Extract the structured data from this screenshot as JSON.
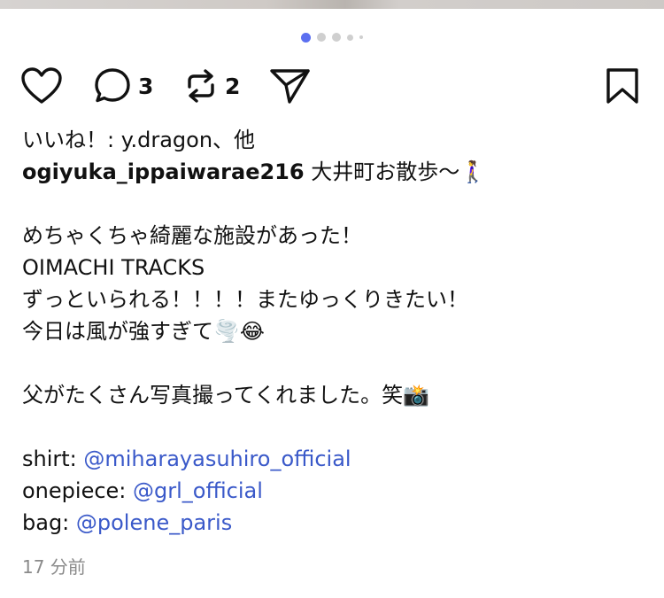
{
  "carousel": {
    "dot_count": 5,
    "active_index": 0
  },
  "actions": {
    "comment_count": "3",
    "repost_count": "2"
  },
  "likes": {
    "text": "いいね！: y.dragon、他"
  },
  "caption": {
    "username": "ogiyuka_ippaiwarae216",
    "first_line": " 大井町お散歩〜",
    "emoji_walk": "🚶‍♀️",
    "line2": "めちゃくちゃ綺麗な施設があった！",
    "line3": "OIMACHI TRACKS",
    "line4": "ずっといられる！！！！またゆっくりきたい！",
    "line5": "今日は風が強すぎて",
    "emoji_wind": "🌪️",
    "emoji_laugh": "😂",
    "line6": "父がたくさん写真撮ってくれました。笑",
    "emoji_camera": "📸",
    "shirt_label": "shirt: ",
    "shirt_mention": "@miharayasuhiro_official",
    "onepiece_label": "onepiece: ",
    "onepiece_mention": "@grl_official",
    "bag_label": "bag: ",
    "bag_mention": "@polene_paris"
  },
  "timestamp": "17 分前",
  "colors": {
    "active_dot": "#5b6ff0",
    "inactive_dot": "#cfcfcf",
    "mention": "#3a59c9",
    "timestamp": "#8a8a8a"
  }
}
